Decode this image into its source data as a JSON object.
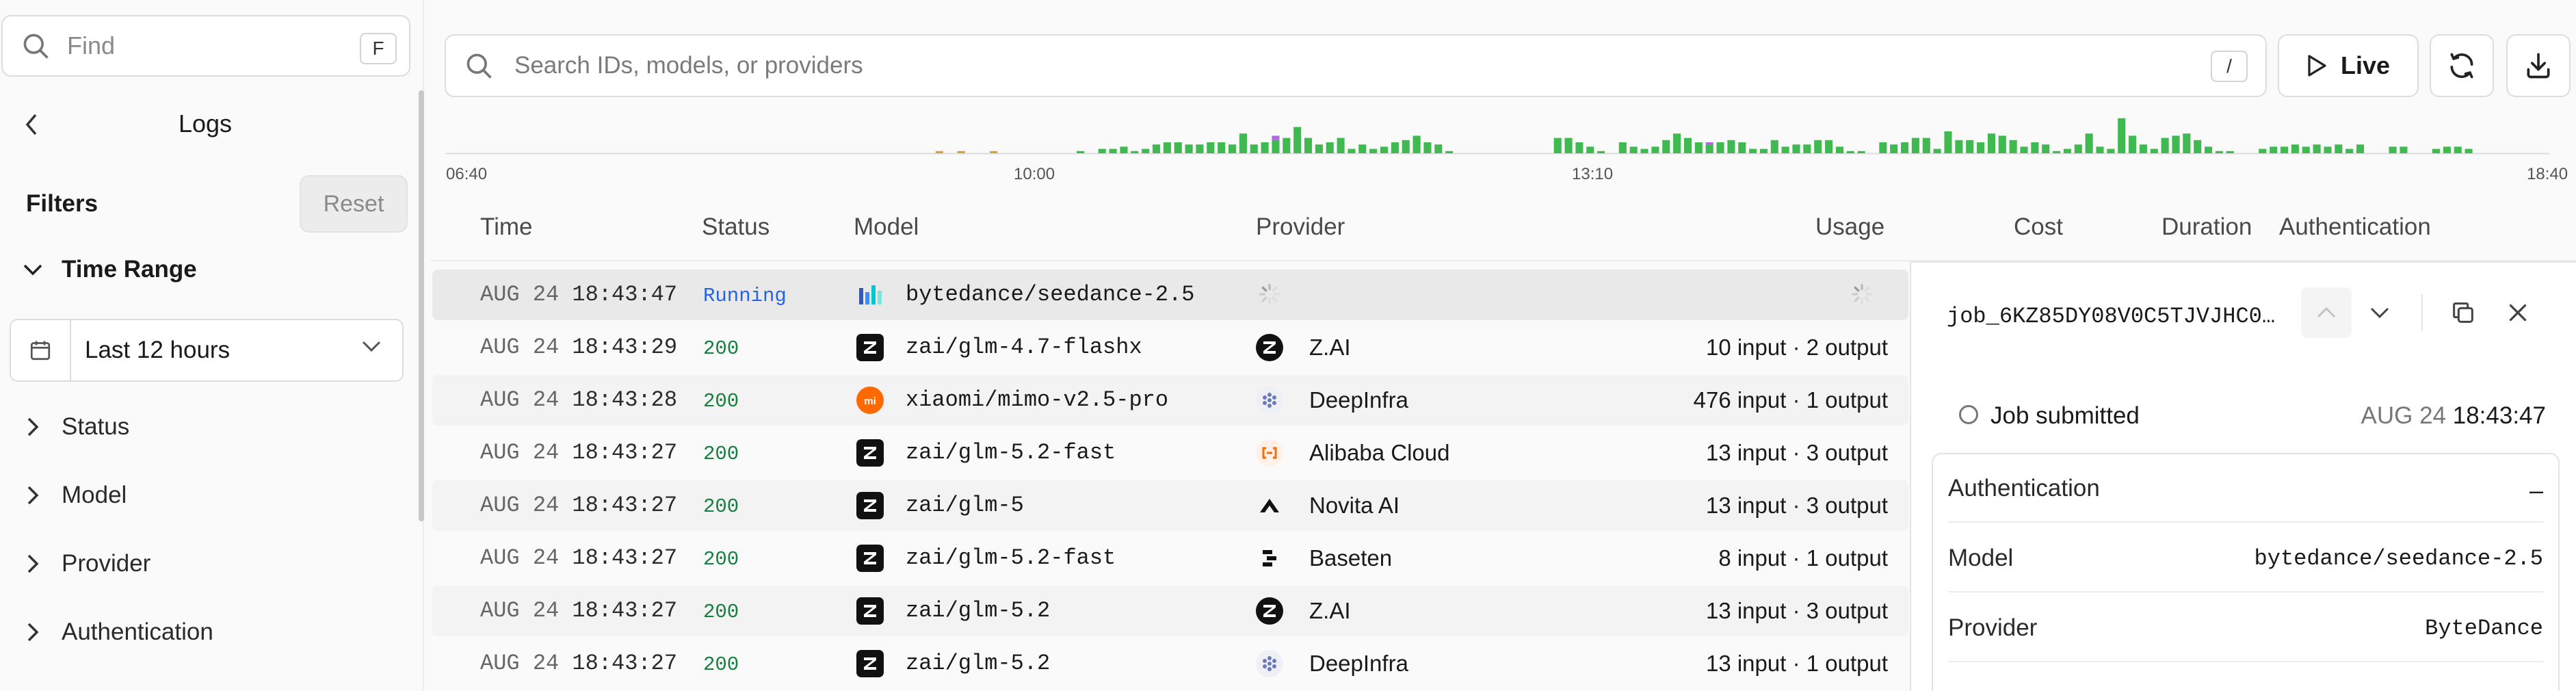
{
  "sidebar": {
    "find_placeholder": "Find",
    "find_shortcut": "F",
    "title": "Logs",
    "filters_heading": "Filters",
    "reset_label": "Reset",
    "time_range_label": "Time Range",
    "time_range_value": "Last 12 hours",
    "filter_groups": [
      "Status",
      "Model",
      "Provider",
      "Authentication"
    ]
  },
  "toolbar": {
    "search_placeholder": "Search IDs, models, or providers",
    "search_shortcut": "/",
    "live_label": "Live"
  },
  "histogram": {
    "ticks": [
      "06:40",
      "10:00",
      "13:10",
      "18:40"
    ],
    "colors": {
      "success": "#3fb950",
      "error": "#b06ad9",
      "warning": "#d9a23f",
      "empty": "#e3e3e3"
    },
    "bars": [
      0,
      0,
      0,
      0,
      0,
      0,
      0,
      0,
      0,
      0,
      0,
      0,
      0,
      0,
      0,
      0,
      0,
      0,
      0,
      0,
      0,
      0,
      0,
      0,
      0,
      0,
      0,
      0,
      0,
      0,
      0,
      0,
      0,
      0,
      0,
      0,
      0,
      0,
      0,
      0,
      0,
      0,
      0,
      0,
      0,
      1,
      0,
      1,
      0,
      0,
      1,
      0,
      0,
      0,
      0,
      0,
      0,
      0,
      1,
      0,
      2,
      2,
      3,
      1,
      2,
      4,
      5,
      5,
      4,
      4,
      5,
      5,
      4,
      9,
      4,
      5,
      6,
      7,
      12,
      7,
      4,
      5,
      7,
      2,
      4,
      2,
      3,
      5,
      6,
      8,
      5,
      4,
      1,
      0,
      0,
      0,
      0,
      0,
      0,
      0,
      0,
      0,
      7,
      7,
      5,
      3,
      1,
      0,
      5,
      3,
      2,
      3,
      6,
      9,
      7,
      5,
      4,
      5,
      6,
      5,
      2,
      2,
      6,
      3,
      4,
      4,
      6,
      6,
      3,
      1,
      1,
      0,
      5,
      4,
      5,
      7,
      7,
      2,
      10,
      6,
      6,
      5,
      9,
      8,
      6,
      3,
      5,
      4,
      1,
      2,
      4,
      9,
      3,
      2,
      16,
      8,
      4,
      2,
      7,
      8,
      9,
      6,
      3,
      1,
      1,
      0,
      0,
      2,
      3,
      3,
      4,
      3,
      4,
      3,
      4,
      2,
      4,
      0,
      0,
      3,
      3,
      0,
      0,
      2,
      3,
      3,
      2,
      0,
      0,
      0,
      0,
      0,
      0,
      0
    ],
    "errors": {
      "76": 2,
      "116": 1
    },
    "warnings": [
      45,
      47,
      50
    ]
  },
  "table": {
    "headers": [
      "Time",
      "Status",
      "Model",
      "Provider",
      "Usage",
      "Cost",
      "Duration",
      "Authentication"
    ],
    "rows": [
      {
        "date": "AUG 24",
        "time": "18:43:47",
        "status": "Running",
        "model": "bytedance/seedance-2.5",
        "model_icon": "bytedance-icon",
        "provider": "",
        "provider_icon": "",
        "usage": ""
      },
      {
        "date": "AUG 24",
        "time": "18:43:29",
        "status": "200",
        "model": "zai/glm-4.7-flashx",
        "model_icon": "zai-icon",
        "provider": "Z.AI",
        "provider_icon": "zai-icon",
        "usage": "10 input · 2 output"
      },
      {
        "date": "AUG 24",
        "time": "18:43:28",
        "status": "200",
        "model": "xiaomi/mimo-v2.5-pro",
        "model_icon": "xiaomi-icon",
        "provider": "DeepInfra",
        "provider_icon": "deepinfra-icon",
        "usage": "476 input · 1 output"
      },
      {
        "date": "AUG 24",
        "time": "18:43:27",
        "status": "200",
        "model": "zai/glm-5.2-fast",
        "model_icon": "zai-icon",
        "provider": "Alibaba Cloud",
        "provider_icon": "alibaba-icon",
        "usage": "13 input · 3 output"
      },
      {
        "date": "AUG 24",
        "time": "18:43:27",
        "status": "200",
        "model": "zai/glm-5",
        "model_icon": "zai-icon",
        "provider": "Novita AI",
        "provider_icon": "novita-icon",
        "usage": "13 input · 3 output"
      },
      {
        "date": "AUG 24",
        "time": "18:43:27",
        "status": "200",
        "model": "zai/glm-5.2-fast",
        "model_icon": "zai-icon",
        "provider": "Baseten",
        "provider_icon": "baseten-icon",
        "usage": "8 input · 1 output"
      },
      {
        "date": "AUG 24",
        "time": "18:43:27",
        "status": "200",
        "model": "zai/glm-5.2",
        "model_icon": "zai-icon",
        "provider": "Z.AI",
        "provider_icon": "zai-icon",
        "usage": "13 input · 3 output"
      },
      {
        "date": "AUG 24",
        "time": "18:43:27",
        "status": "200",
        "model": "zai/glm-5.2",
        "model_icon": "zai-icon",
        "provider": "DeepInfra",
        "provider_icon": "deepinfra-icon",
        "usage": "13 input · 1 output"
      }
    ]
  },
  "detail": {
    "job_id": "job_6KZ85DY08V0C5TJVJHC0…",
    "status": "Job submitted",
    "date": "AUG 24",
    "time": "18:43:47",
    "fields": [
      {
        "key": "Authentication",
        "value": "–"
      },
      {
        "key": "Model",
        "value": "bytedance/seedance-2.5"
      },
      {
        "key": "Provider",
        "value": "ByteDance"
      }
    ]
  }
}
